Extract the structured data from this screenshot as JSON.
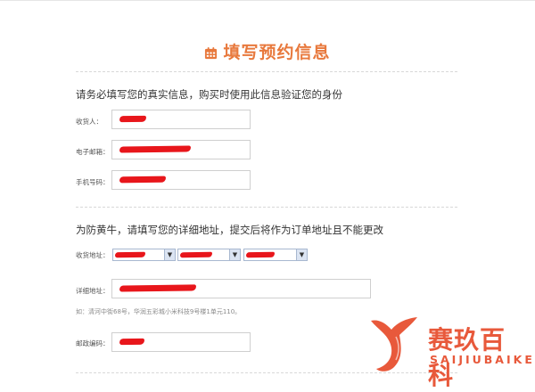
{
  "header": {
    "title": "填写预约信息",
    "icon": "calendar-icon"
  },
  "section1": {
    "heading": "请务必填写您的真实信息，购买时使用此信息验证您的身份",
    "fields": [
      {
        "label": "收货人：",
        "value": ""
      },
      {
        "label": "电子邮箱：",
        "value": ""
      },
      {
        "label": "手机号码：",
        "value": ""
      }
    ]
  },
  "section2": {
    "heading": "为防黄牛，请填写您的详细地址，提交后将作为订单地址且不能更改",
    "region_label": "收货地址：",
    "region_selects": [
      "",
      "",
      ""
    ],
    "address_label": "详细地址：",
    "address_value": "",
    "hint": "如：清河中街68号，华润五彩城小米科技9号楼1单元110。",
    "zip_label": "邮政编码：",
    "zip_value": ""
  },
  "watermark": {
    "name_cn": "赛玖百科",
    "name_en": "SAIJIUBAIKE"
  },
  "colors": {
    "accent": "#e8793d",
    "redaction": "#e8161b",
    "logo": "#e8593b"
  }
}
